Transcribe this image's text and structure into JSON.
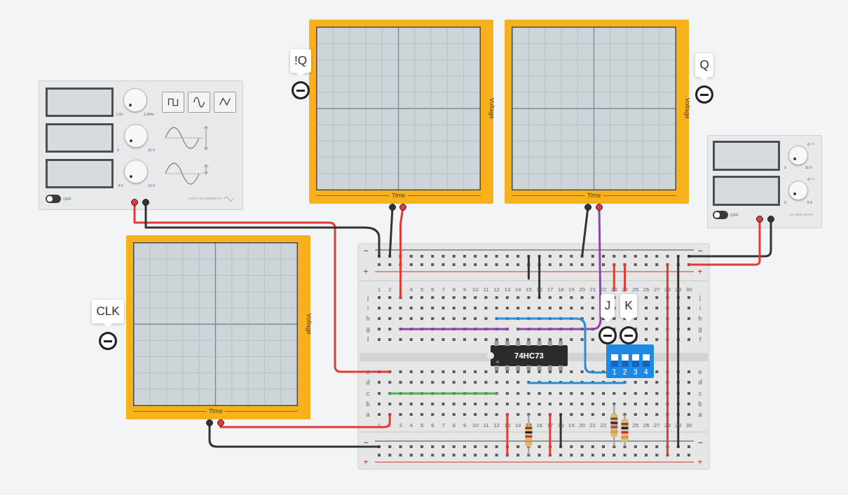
{
  "function_generator": {
    "knobs": [
      {
        "min": "1 Hz",
        "max": "1 MHz",
        "level": 0
      },
      {
        "min": "0",
        "max": "10 V",
        "level": 0
      },
      {
        "min": "-5 V",
        "max": "+5 V",
        "level": 0
      }
    ],
    "waveforms": [
      {
        "kind": "square"
      },
      {
        "kind": "sine"
      },
      {
        "kind": "triangle"
      }
    ],
    "power": {
      "label": "OFF",
      "on": false
    },
    "brand": "FUNCTION GENERATOR"
  },
  "power_supply": {
    "knobs": [
      {
        "min": "0",
        "max": "30 V",
        "indicator": "VC",
        "level": 0
      },
      {
        "min": "0",
        "max": "5 A",
        "indicator": "CC",
        "level": 0
      }
    ],
    "power": {
      "label": "OFF",
      "on": false
    },
    "brand": "VOLTAGE SUPPLY"
  },
  "scopes": [
    {
      "x_label": "Time",
      "y_label": "Voltage"
    },
    {
      "x_label": "Time",
      "y_label": "Voltage"
    },
    {
      "x_label": "Time",
      "y_label": "Voltage"
    }
  ],
  "probes": [
    {
      "label": "!Q"
    },
    {
      "label": "Q"
    },
    {
      "label": "CLK"
    },
    {
      "label": "J"
    },
    {
      "label": "K"
    }
  ],
  "breadboard": {
    "columns": [
      "1",
      "2",
      "3",
      "4",
      "5",
      "6",
      "7",
      "8",
      "9",
      "10",
      "11",
      "12",
      "13",
      "14",
      "15",
      "16",
      "17",
      "18",
      "19",
      "20",
      "21",
      "22",
      "23",
      "24",
      "25",
      "26",
      "27",
      "28",
      "29",
      "30"
    ],
    "rows_top": [
      "j",
      "i",
      "h",
      "g",
      "f"
    ],
    "rows_bottom": [
      "e",
      "d",
      "c",
      "b",
      "a"
    ],
    "rail_minus": "−",
    "rail_plus": "+"
  },
  "chip": {
    "label": "74HC73"
  },
  "dip_switch": {
    "switches": [
      {
        "label": "1",
        "on": true
      },
      {
        "label": "2",
        "on": true
      },
      {
        "label": "3",
        "on": true
      },
      {
        "label": "4",
        "on": true
      }
    ]
  }
}
